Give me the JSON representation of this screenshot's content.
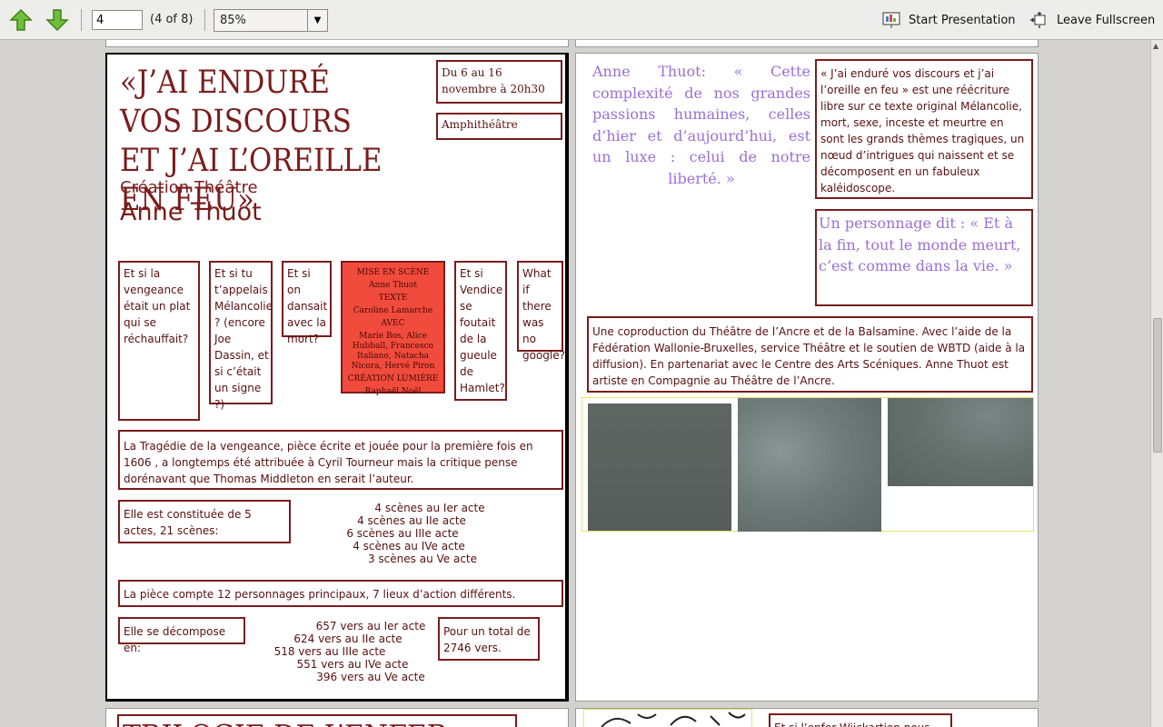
{
  "toolbar": {
    "page_value": "4",
    "page_count": "(4 of 8)",
    "zoom": "85%",
    "start_presentation": "Start Presentation",
    "leave_fullscreen": "Leave Fullscreen"
  },
  "left_page": {
    "title": "«J’AI ENDURÉ VOS DISCOURS ET J’AI L’OREILLE EN FEU»",
    "subtitle": "Création Théâtre",
    "author": "Anne Thuot",
    "date": "Du 6 au 16 novembre à 20h30",
    "venue": "Amphithéâtre",
    "questions": [
      "Et si la vengeance était un plat qui se réchauffait?",
      "Et si tu t’appelais Mélancolie ? (encore Joe Dassin, et si c’était un signe ?)",
      "Et si on dansait avec la mort?",
      "Et si Vendice se foutait de la gueule de Hamlet?",
      "What if there was no google?"
    ],
    "credits": [
      "MISE EN SCÈNE",
      "Anne Thuot",
      "TEXTE",
      "Caroline Lamarche",
      "AVEC",
      "Marie Bos, Alice Hubball, Francesco Italiano, Natacha Nicora, Hervé Piron",
      "CRÉATION LUMIÈRE",
      "Raphaël Noël"
    ],
    "tragedy_text": "La Tragédie de la vengeance, pièce écrite et jouée pour la première fois en 1606 , a longtemps été attribuée à Cyril Tourneur mais la critique pense dorénavant que Thomas Middleton en serait l’auteur.",
    "acts_label": "Elle est constituée de 5 actes, 21 scènes:",
    "acts": [
      "4 scènes au Ier acte",
      "4 scènes au IIe acte",
      "6 scènes au IIIe acte",
      "4 scènes au IVe acte",
      "3 scènes au Ve acte"
    ],
    "characters": "La pièce compte 12 personnages principaux, 7 lieux d’action différents.",
    "verses_label": "Elle se décompose en:",
    "verses": [
      "657 vers au Ier acte",
      "624 vers au IIe acte",
      "518 vers au IIIe acte",
      "551 vers au IVe acte",
      "396 vers au Ve acte"
    ],
    "total": "Pour un total de 2746 vers."
  },
  "right_page": {
    "quote": "Anne Thuot: « Cette complexité de nos grandes passions humaines, celles d’hier et d’aujourd’hui, est un luxe : celui de notre liberté. »",
    "rewrite": "« J’ai enduré vos discours et j’ai l’oreille en feu » est une réécriture libre sur ce texte original Mélancolie, mort, sexe, inceste et meurtre en sont les grands thèmes tragiques, un nœud d’intrigues qui naissent et se décomposent en un fabuleux kaléidoscope.",
    "character_quote": "Un personnage dit : « Et à la fin, tout le monde meurt, c’est comme dans la vie. »",
    "coproduction": "Une coproduction du Théâtre de l’Ancre et de la Balsamine. Avec l’aide de la Fédération Wallonie-Bruxelles, service Théâtre et le soutien de WBTD (aide à la diffusion). En partenariat avec le Centre des Arts Scéniques. Anne Thuot est artiste en Compagnie au Théâtre de l’Ancre."
  },
  "next_page": {
    "heading_partial": "TRILOGIE DE L’ENFER",
    "box_partial": "Et si l’enfer Wiickartien nous"
  },
  "colors": {
    "maroon": "#7a1c1c",
    "red_fill": "#f04b3c",
    "lavender": "#9b6fd6"
  }
}
